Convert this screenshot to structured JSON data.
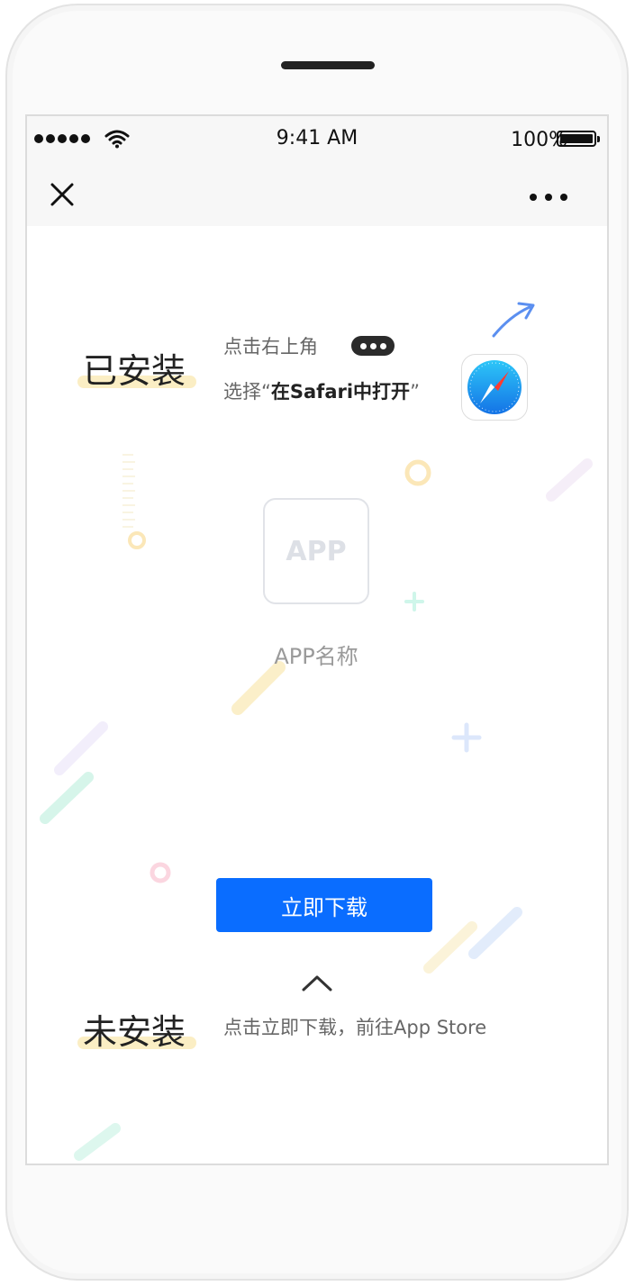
{
  "status_bar": {
    "time": "9:41 AM",
    "battery": "100%"
  },
  "nav": {
    "close_icon": "close-icon",
    "more_icon": "more-icon"
  },
  "installed": {
    "title": "已安装",
    "hint_line1": "点击右上角",
    "hint_line2_prefix": "选择“",
    "hint_line2_bold": "在Safari中打开",
    "hint_line2_suffix": "”"
  },
  "app": {
    "icon_text": "APP",
    "name": "APP名称"
  },
  "download_button": "立即下载",
  "not_installed": {
    "title": "未安装",
    "hint": "点击立即下载，前往App Store"
  },
  "colors": {
    "accent": "#0a6dff",
    "highlight": "#fbeec4"
  }
}
